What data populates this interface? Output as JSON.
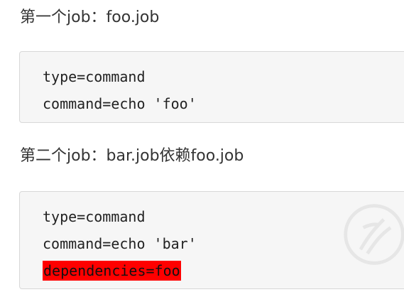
{
  "paragraphs": [
    {
      "text": "第一个job：foo.job"
    },
    {
      "text": "第二个job：bar.job依赖foo.job"
    }
  ],
  "code_blocks": [
    {
      "lines": [
        "type=command",
        "command=echo 'foo'"
      ]
    },
    {
      "lines": [
        "type=command",
        "command=echo 'bar'",
        "dependencies=foo"
      ],
      "highlighted_line": "dependencies=foo"
    }
  ],
  "colors": {
    "highlight": "#ff0000",
    "code_background": "#f6f6f6",
    "text": "#333333"
  }
}
